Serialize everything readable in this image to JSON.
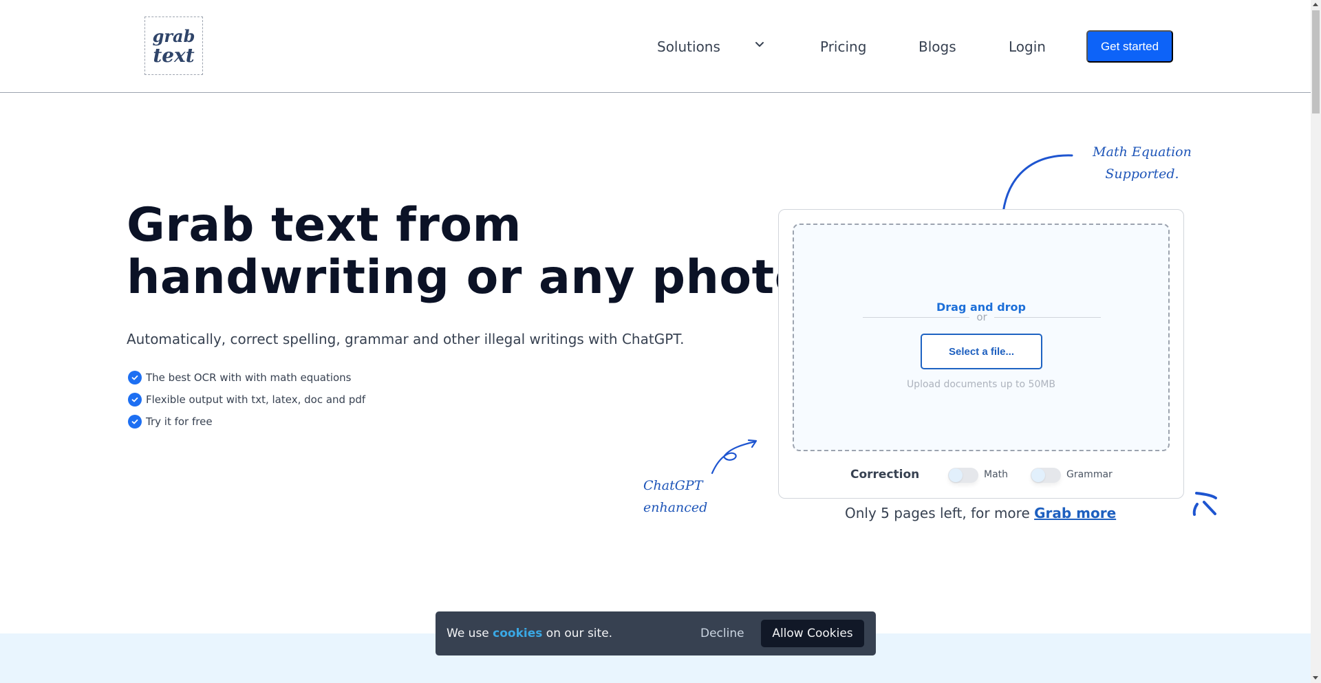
{
  "header": {
    "logo": {
      "line1": "grab",
      "line2": "text"
    },
    "nav": {
      "solutions": "Solutions",
      "pricing": "Pricing",
      "blogs": "Blogs",
      "login": "Login"
    },
    "cta": "Get started"
  },
  "hero": {
    "title_line1": "Grab text from",
    "title_line2": "handwriting or any photo",
    "subtitle": "Automatically, correct spelling, grammar and other illegal writings with ChatGPT.",
    "features": [
      "The best OCR with with math equations",
      "Flexible output with txt, latex, doc and pdf",
      "Try it for free"
    ]
  },
  "annotations": {
    "math_line1": "Math Equation",
    "math_line2": "Supported.",
    "chat_line1": "ChatGPT",
    "chat_line2": "enhanced"
  },
  "upload": {
    "drag_text": "Drag and drop",
    "or_text": "or",
    "select_button": "Select a file...",
    "note": "Upload documents up to 50MB",
    "correction_label": "Correction",
    "toggles": [
      {
        "label": "Math",
        "on": false
      },
      {
        "label": "Grammar",
        "on": false
      }
    ],
    "pages_left_text": "Only 5 pages left, for more ",
    "grab_more_link": "Grab more"
  },
  "cookie": {
    "text_before": "We use ",
    "link": "cookies",
    "text_after": " on our site.",
    "decline": "Decline",
    "allow": "Allow Cookies"
  },
  "colors": {
    "brand_blue": "#0d63f8",
    "accent_blue": "#1d5fbf",
    "title_dark": "#0b1226",
    "cookie_bg": "#374151"
  }
}
